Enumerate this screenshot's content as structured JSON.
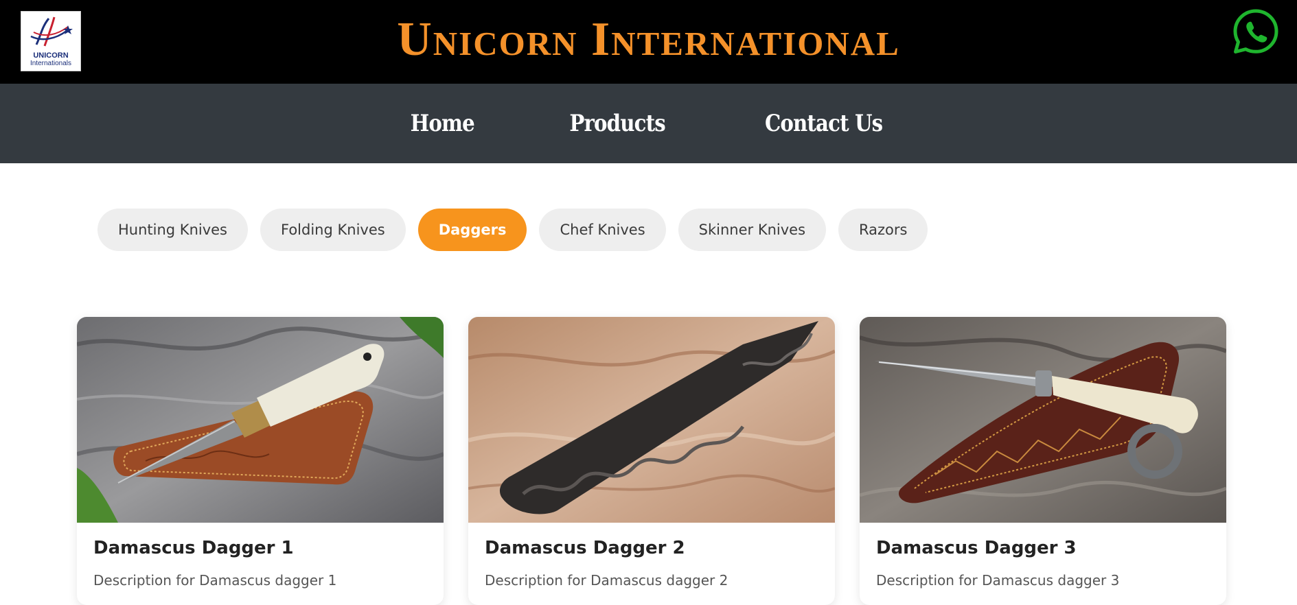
{
  "header": {
    "logo_line1": "UNICORN",
    "logo_line2": "Internationals",
    "brand_title": "Unicorn International",
    "whatsapp_icon": "whatsapp-icon",
    "brand_color": "#f4912a"
  },
  "nav": {
    "items": [
      {
        "label": "Home"
      },
      {
        "label": "Products"
      },
      {
        "label": "Contact Us"
      }
    ]
  },
  "filters": {
    "active_color": "#f7941d",
    "items": [
      {
        "label": "Hunting Knives",
        "active": false
      },
      {
        "label": "Folding Knives",
        "active": false
      },
      {
        "label": "Daggers",
        "active": true
      },
      {
        "label": "Chef Knives",
        "active": false
      },
      {
        "label": "Skinner Knives",
        "active": false
      },
      {
        "label": "Razors",
        "active": false
      }
    ]
  },
  "products": [
    {
      "title": "Damascus Dagger 1",
      "description": "Description for Damascus dagger 1"
    },
    {
      "title": "Damascus Dagger 2",
      "description": "Description for Damascus dagger 2"
    },
    {
      "title": "Damascus Dagger 3",
      "description": "Description for Damascus dagger 3"
    }
  ]
}
